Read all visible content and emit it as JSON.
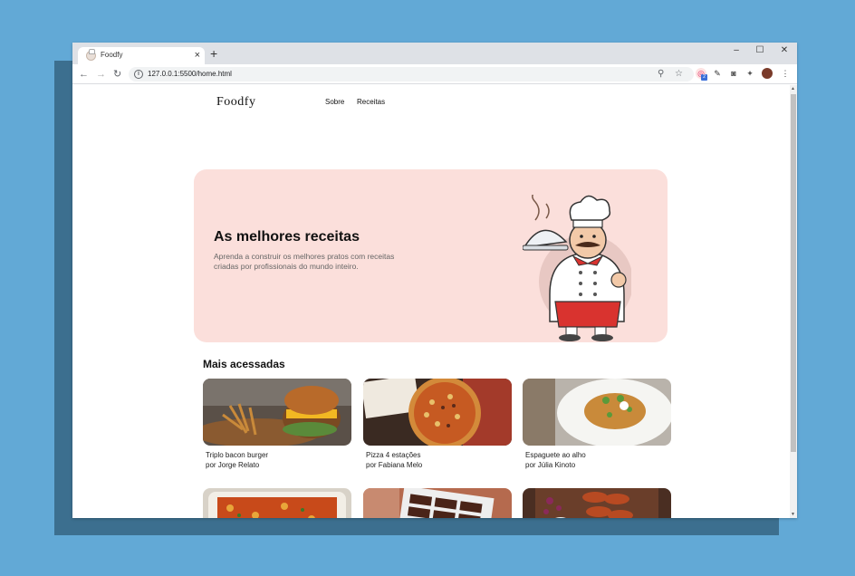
{
  "browser": {
    "tab_title": "Foodfy",
    "url": "127.0.0.1:5500/home.html",
    "extension_badge": "2"
  },
  "site": {
    "logo": "Foodfy",
    "nav": [
      "Sobre",
      "Receitas"
    ]
  },
  "hero": {
    "title": "As melhores receitas",
    "description": "Aprenda a construir os melhores pratos com receitas criadas por profissionais do mundo inteiro."
  },
  "section": {
    "title": "Mais acessadas"
  },
  "recipes": [
    {
      "title": "Triplo bacon burger",
      "author": "por Jorge Relato"
    },
    {
      "title": "Pizza 4 estações",
      "author": "por Fabiana Melo"
    },
    {
      "title": "Espaguete ao alho",
      "author": "por Júlia Kinoto"
    },
    {
      "title": "",
      "author": ""
    },
    {
      "title": "",
      "author": ""
    },
    {
      "title": "",
      "author": ""
    }
  ],
  "colors": {
    "background": "#62a9d6",
    "hero_bg": "#fbdfdb",
    "tabbar": "#dee1e6"
  },
  "icons": [
    "back-icon",
    "forward-icon",
    "reload-icon",
    "info-icon",
    "zoom-icon",
    "star-icon",
    "extension-icon",
    "puzzle-icon",
    "avatar",
    "menu-icon"
  ]
}
